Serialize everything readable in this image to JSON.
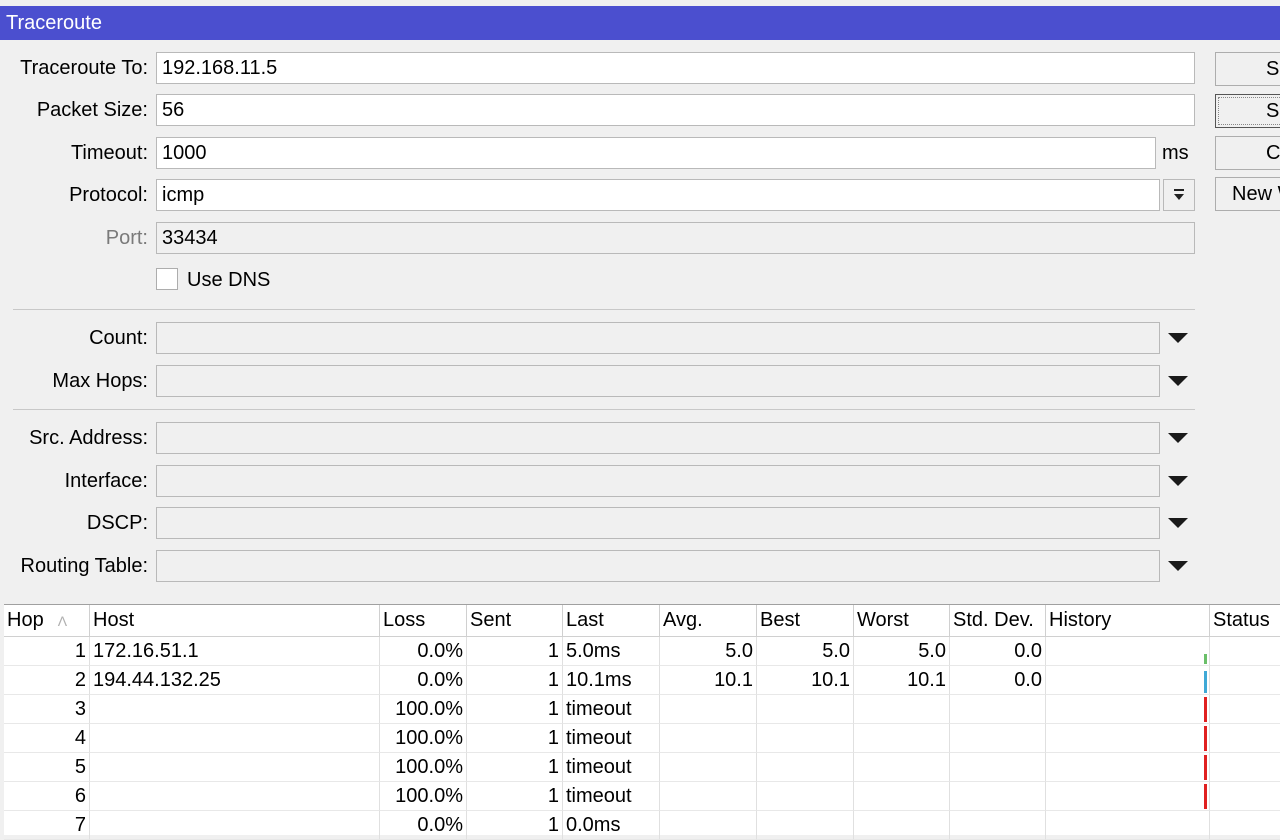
{
  "window": {
    "title": "Traceroute"
  },
  "form": {
    "traceroute_to": {
      "label": "Traceroute To:",
      "value": "192.168.11.5"
    },
    "packet_size": {
      "label": "Packet Size:",
      "value": "56"
    },
    "timeout": {
      "label": "Timeout:",
      "value": "1000",
      "unit": "ms"
    },
    "protocol": {
      "label": "Protocol:",
      "value": "icmp"
    },
    "port": {
      "label": "Port:",
      "value": "33434"
    },
    "use_dns": {
      "label": "Use DNS",
      "checked": false
    },
    "count": {
      "label": "Count:",
      "value": ""
    },
    "max_hops": {
      "label": "Max Hops:",
      "value": ""
    },
    "src_address": {
      "label": "Src. Address:",
      "value": ""
    },
    "interface": {
      "label": "Interface:",
      "value": ""
    },
    "dscp": {
      "label": "DSCP:",
      "value": ""
    },
    "routing_table": {
      "label": "Routing Table:",
      "value": ""
    }
  },
  "buttons": {
    "start": "S",
    "stop": "S",
    "close": "C",
    "new_window": "New W"
  },
  "table": {
    "columns": [
      "Hop",
      "Host",
      "Loss",
      "Sent",
      "Last",
      "Avg.",
      "Best",
      "Worst",
      "Std. Dev.",
      "History",
      "Status"
    ],
    "sort_indicator": "Λ",
    "rows": [
      {
        "hop": "1",
        "host": "172.16.51.1",
        "loss": "0.0%",
        "sent": "1",
        "last": "5.0ms",
        "avg": "5.0",
        "best": "5.0",
        "worst": "5.0",
        "std": "0.0",
        "history_color": "#6abf69"
      },
      {
        "hop": "2",
        "host": "194.44.132.25",
        "loss": "0.0%",
        "sent": "1",
        "last": "10.1ms",
        "avg": "10.1",
        "best": "10.1",
        "worst": "10.1",
        "std": "0.0",
        "history_color": "#3fa9d6"
      },
      {
        "hop": "3",
        "host": "",
        "loss": "100.0%",
        "sent": "1",
        "last": "timeout",
        "avg": "",
        "best": "",
        "worst": "",
        "std": "",
        "history_color": "#e02020"
      },
      {
        "hop": "4",
        "host": "",
        "loss": "100.0%",
        "sent": "1",
        "last": "timeout",
        "avg": "",
        "best": "",
        "worst": "",
        "std": "",
        "history_color": "#e02020"
      },
      {
        "hop": "5",
        "host": "",
        "loss": "100.0%",
        "sent": "1",
        "last": "timeout",
        "avg": "",
        "best": "",
        "worst": "",
        "std": "",
        "history_color": "#e02020"
      },
      {
        "hop": "6",
        "host": "",
        "loss": "100.0%",
        "sent": "1",
        "last": "timeout",
        "avg": "",
        "best": "",
        "worst": "",
        "std": "",
        "history_color": "#e02020"
      },
      {
        "hop": "7",
        "host": "",
        "loss": "0.0%",
        "sent": "1",
        "last": "0.0ms",
        "avg": "",
        "best": "",
        "worst": "",
        "std": "",
        "history_color": ""
      }
    ]
  }
}
